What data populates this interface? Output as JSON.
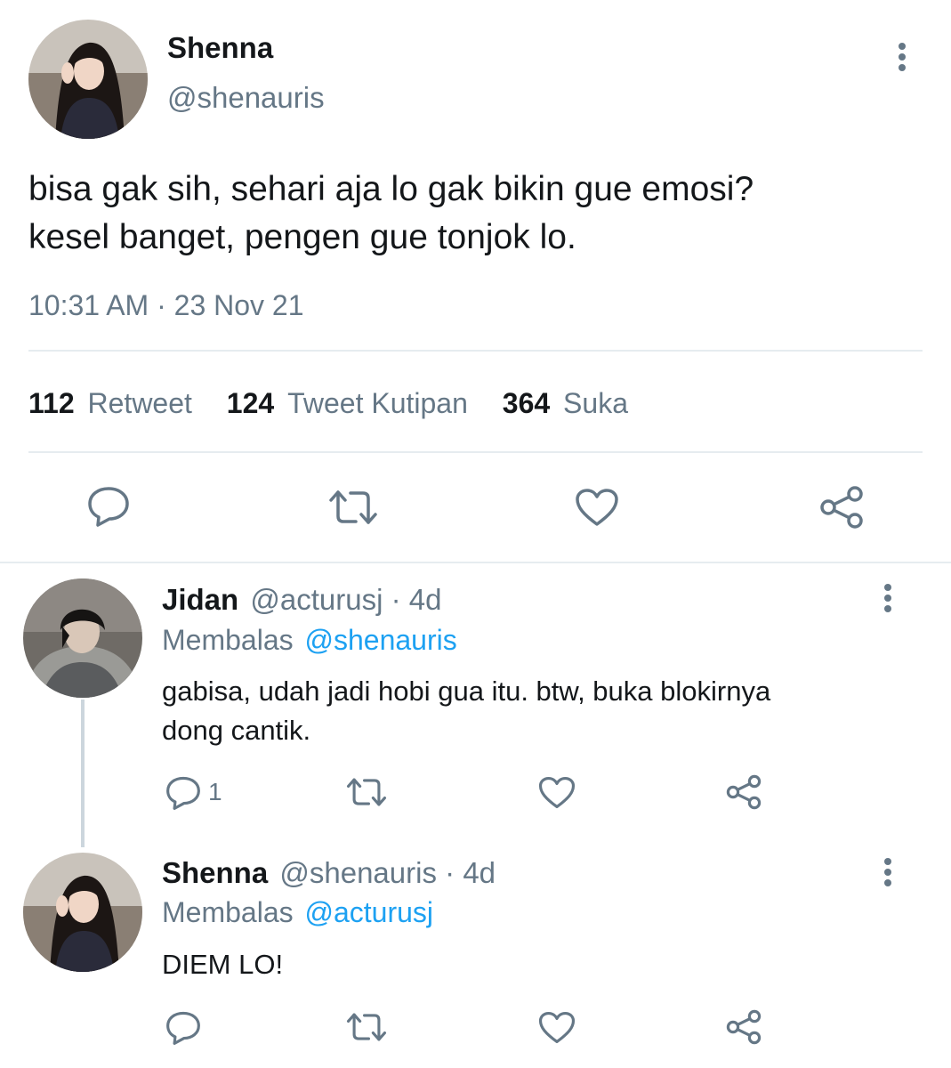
{
  "main_tweet": {
    "display_name": "Shenna",
    "handle": "@shenauris",
    "text_line1": "bisa gak sih, sehari aja lo gak bikin gue emosi?",
    "text_line2": "kesel banget, pengen gue tonjok lo.",
    "timestamp": "10:31 AM · 23 Nov 21",
    "stats": {
      "retweet_count": "112",
      "retweet_label": "Retweet",
      "quote_count": "124",
      "quote_label": "Tweet Kutipan",
      "like_count": "364",
      "like_label": "Suka"
    },
    "actions": [
      "reply-icon",
      "retweet-icon",
      "heart-icon",
      "share-icon"
    ]
  },
  "replies": [
    {
      "display_name": "Jidan",
      "handle": "@acturusj",
      "separator": "·",
      "age": "4d",
      "replying_label": "Membalas",
      "replying_to": "@shenauris",
      "text_line1": "gabisa, udah jadi hobi gua itu. btw, buka blokirnya",
      "text_line2": "dong cantik.",
      "reply_count": "1"
    },
    {
      "display_name": "Shenna",
      "handle": "@shenauris",
      "separator": "·",
      "age": "4d",
      "replying_label": "Membalas",
      "replying_to": "@acturusj",
      "text_line1": "DIEM LO!",
      "reply_count": ""
    }
  ],
  "colors": {
    "text": "#14171a",
    "secondary": "#657786",
    "accent": "#1da1f2",
    "divider": "#e6ecf0",
    "icon": "#657786"
  }
}
